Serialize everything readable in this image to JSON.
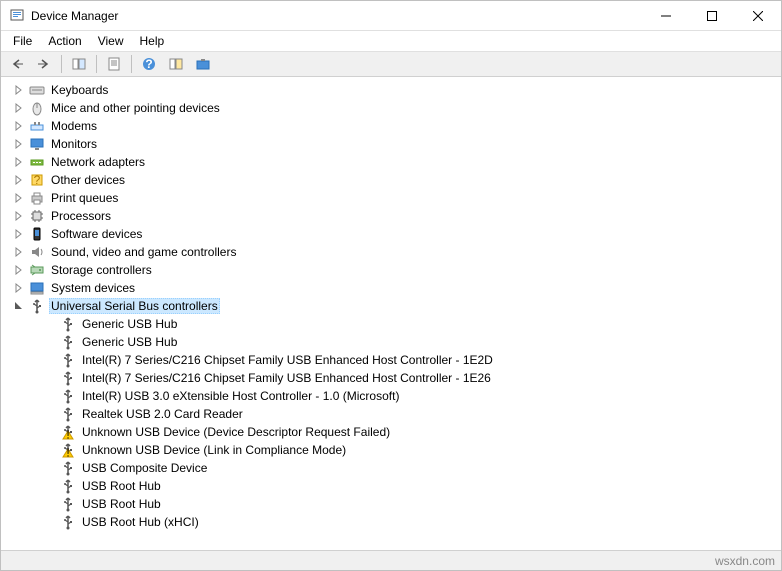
{
  "title": "Device Manager",
  "menus": [
    "File",
    "Action",
    "View",
    "Help"
  ],
  "categories": [
    {
      "icon": "keyboard",
      "label": "Keyboards"
    },
    {
      "icon": "mouse",
      "label": "Mice and other pointing devices"
    },
    {
      "icon": "modem",
      "label": "Modems"
    },
    {
      "icon": "monitor",
      "label": "Monitors"
    },
    {
      "icon": "network",
      "label": "Network adapters"
    },
    {
      "icon": "other",
      "label": "Other devices"
    },
    {
      "icon": "printer",
      "label": "Print queues"
    },
    {
      "icon": "processor",
      "label": "Processors"
    },
    {
      "icon": "software",
      "label": "Software devices"
    },
    {
      "icon": "sound",
      "label": "Sound, video and game controllers"
    },
    {
      "icon": "storage",
      "label": "Storage controllers"
    },
    {
      "icon": "system",
      "label": "System devices"
    },
    {
      "icon": "usb",
      "label": "Universal Serial Bus controllers",
      "expanded": true,
      "selected": true
    }
  ],
  "usb_children": [
    {
      "icon": "usb",
      "label": "Generic USB Hub"
    },
    {
      "icon": "usb",
      "label": "Generic USB Hub"
    },
    {
      "icon": "usb",
      "label": "Intel(R) 7 Series/C216 Chipset Family USB Enhanced Host Controller - 1E2D"
    },
    {
      "icon": "usb",
      "label": "Intel(R) 7 Series/C216 Chipset Family USB Enhanced Host Controller - 1E26"
    },
    {
      "icon": "usb",
      "label": "Intel(R) USB 3.0 eXtensible Host Controller - 1.0 (Microsoft)"
    },
    {
      "icon": "usb",
      "label": "Realtek USB 2.0 Card Reader"
    },
    {
      "icon": "usb-warn",
      "label": "Unknown USB Device (Device Descriptor Request Failed)"
    },
    {
      "icon": "usb-warn",
      "label": "Unknown USB Device (Link in Compliance Mode)"
    },
    {
      "icon": "usb",
      "label": "USB Composite Device"
    },
    {
      "icon": "usb",
      "label": "USB Root Hub"
    },
    {
      "icon": "usb",
      "label": "USB Root Hub"
    },
    {
      "icon": "usb",
      "label": "USB Root Hub (xHCI)"
    }
  ],
  "footer": "wsxdn.com"
}
